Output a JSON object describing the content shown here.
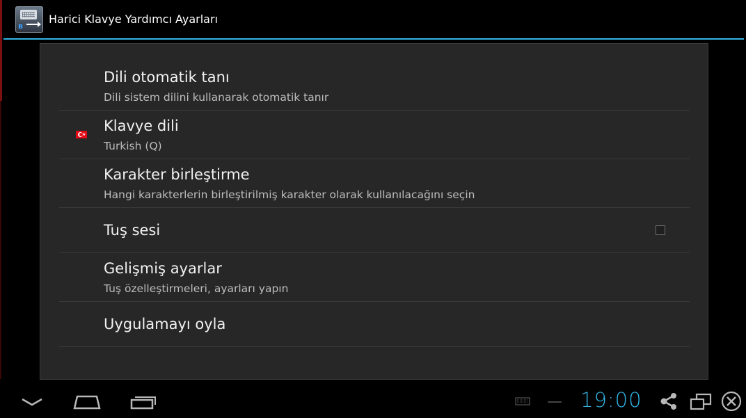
{
  "action_bar": {
    "title": "Harici Klavye Yardımcı Ayarları",
    "accent_color": "#33b5e5",
    "icon": "keyboard-bluetooth-usb-icon"
  },
  "preferences": [
    {
      "title": "Dili otomatik tanı",
      "summary": "Dili sistem dilini kullanarak otomatik tanır"
    },
    {
      "title": "Klavye dili",
      "summary": "Turkish (Q)",
      "icon": "turkey-flag-icon"
    },
    {
      "title": "Karakter birleştirme",
      "summary": "Hangi karakterlerin birleştirilmiş karakter olarak kullanılacağını seçin"
    },
    {
      "title": "Tuş sesi",
      "summary": "",
      "checkbox": false
    },
    {
      "title": "Gelişmiş ayarlar",
      "summary": "Tuş özelleştirmeleri, ayarları yapın"
    },
    {
      "title": "Uygulamayı oyla",
      "summary": ""
    }
  ],
  "system_bar": {
    "clock": "19:00",
    "clock_color": "#33b5e5",
    "icons": [
      "hide-keyboard-icon",
      "home-icon",
      "recent-apps-icon",
      "keyboard-status-icon",
      "share-icon",
      "screen-resize-icon",
      "close-icon"
    ]
  }
}
